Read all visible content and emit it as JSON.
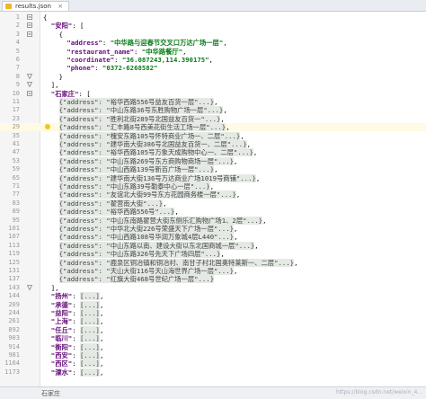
{
  "tab": {
    "label": "results.json",
    "close": "×"
  },
  "status": {
    "breadcrumb": "石家庄",
    "watermark": "https://blog.csdn.net/weixin_4..."
  },
  "lines": [
    {
      "n": "1",
      "t": "{",
      "fold": "open"
    },
    {
      "n": "2",
      "t": "  \"安阳\": [",
      "k": "安阳",
      "fold": "open"
    },
    {
      "n": "3",
      "t": "    {",
      "fold": "open"
    },
    {
      "n": "4",
      "pre": "      ",
      "key": "address",
      "val": "中华路与迎春节交叉口万达广场一层",
      "post": ","
    },
    {
      "n": "5",
      "pre": "      ",
      "key": "restaurant_name",
      "val": "中华路餐厅",
      "post": ","
    },
    {
      "n": "6",
      "pre": "      ",
      "key": "coordinate",
      "val": "36.087243,114.390175",
      "post": ","
    },
    {
      "n": "7",
      "pre": "      ",
      "key": "phone",
      "val": "0372-6268582",
      "post": ""
    },
    {
      "n": "8",
      "t": "    }",
      "fold": "close"
    },
    {
      "n": "9",
      "t": "  ],",
      "fold": "close"
    },
    {
      "n": "10",
      "t": "  \"石家庄\": [",
      "k": "石家庄",
      "fold": "open"
    },
    {
      "n": "11",
      "pre": "    ",
      "c": "{\"address\": \"裕华西路556号益友百货一层\"...}",
      "post": ","
    },
    {
      "n": "17",
      "pre": "    ",
      "c": "{\"address\": \"中山东路36号东胜购物广场一层\"...}",
      "post": ","
    },
    {
      "n": "23",
      "pre": "    ",
      "c": "{\"address\": \"胜利北街289号北国益友百货一\"...}",
      "post": ","
    },
    {
      "n": "29",
      "pre": "    ",
      "c": "{\"address\": \"汇丰路8号西美花街生活工场一层\"...}",
      "post": ",",
      "cur": true
    },
    {
      "n": "35",
      "pre": "    ",
      "c": "{\"address\": \"槐安东路105号怀特商业广场一、二层\"...}",
      "post": ","
    },
    {
      "n": "41",
      "pre": "    ",
      "c": "{\"address\": \"建华南大街386号北国益友百货一、二层\"...}",
      "post": ","
    },
    {
      "n": "47",
      "pre": "    ",
      "c": "{\"address\": \"裕华西路105号万象天成购物中心一、二层\"...}",
      "post": ","
    },
    {
      "n": "53",
      "pre": "    ",
      "c": "{\"address\": \"中山东路269号东方商购物商场一层\"...}",
      "post": ","
    },
    {
      "n": "59",
      "pre": "    ",
      "c": "{\"address\": \"中山西路139号新百广场一层\"...}",
      "post": ","
    },
    {
      "n": "65",
      "pre": "    ",
      "c": "{\"address\": \"建华南大街136号万达商业广场1019号商铺\"...}",
      "post": ","
    },
    {
      "n": "71",
      "pre": "    ",
      "c": "{\"address\": \"中山东路39号勒泰中心一层\"...}",
      "post": ","
    },
    {
      "n": "77",
      "pre": "    ",
      "c": "{\"address\": \"友谊北大街99号东方花园商务楼一层\"...}",
      "post": ","
    },
    {
      "n": "83",
      "pre": "    ",
      "c": "{\"address\": \"翟营南大街\"...}",
      "post": ","
    },
    {
      "n": "89",
      "pre": "    ",
      "c": "{\"address\": \"裕华西路556号\"...}",
      "post": ","
    },
    {
      "n": "95",
      "pre": "    ",
      "c": "{\"address\": \"中山东南路翟营大街东侧乐汇购物广场1、2层\"...}",
      "post": ","
    },
    {
      "n": "101",
      "pre": "    ",
      "c": "{\"address\": \"中华北大街226号荣盛天下广场一层\"...}",
      "post": ","
    },
    {
      "n": "107",
      "pre": "    ",
      "c": "{\"address\": \"中山西路108号华润万象城4层L440\"...}",
      "post": ","
    },
    {
      "n": "113",
      "pre": "    ",
      "c": "{\"address\": \"中山东路以南、建设大街以东北国商城一层\"...}",
      "post": ","
    },
    {
      "n": "119",
      "pre": "    ",
      "c": "{\"address\": \"中山东路326号先天下广场四层\"...}",
      "post": ","
    },
    {
      "n": "125",
      "pre": "    ",
      "c": "{\"address\": \"鹿泉区铜冶镇和铜冶村、南甘子村北国奥特莱斯一、二层\"...}",
      "post": ","
    },
    {
      "n": "131",
      "pre": "    ",
      "c": "{\"address\": \"天山大街116号天山海世界广场一层\"...}",
      "post": ","
    },
    {
      "n": "137",
      "pre": "    ",
      "c": "{\"address\": \"红旗大街468号世纪广场一层\"...}",
      "post": ""
    },
    {
      "n": "143",
      "t": "  ],",
      "fold": "close"
    },
    {
      "n": "144",
      "pre": "  ",
      "key": "扬州",
      "arr": true,
      "post": ","
    },
    {
      "n": "209",
      "pre": "  ",
      "key": "承德",
      "arr": true,
      "post": ","
    },
    {
      "n": "244",
      "pre": "  ",
      "key": "益阳",
      "arr": true,
      "post": ","
    },
    {
      "n": "261",
      "pre": "  ",
      "key": "上海",
      "arr": true,
      "post": ","
    },
    {
      "n": "892",
      "pre": "  ",
      "key": "任丘",
      "arr": true,
      "post": ","
    },
    {
      "n": "903",
      "pre": "  ",
      "key": "临川",
      "arr": true,
      "post": ","
    },
    {
      "n": "914",
      "pre": "  ",
      "key": "衡阳",
      "arr": true,
      "post": ","
    },
    {
      "n": "981",
      "pre": "  ",
      "key": "西安",
      "arr": true,
      "post": ","
    },
    {
      "n": "1164",
      "pre": "  ",
      "key": "西区",
      "arr": true,
      "post": ","
    },
    {
      "n": "1173",
      "pre": "  ",
      "key": "溧水",
      "arr": true,
      "post": ","
    }
  ]
}
